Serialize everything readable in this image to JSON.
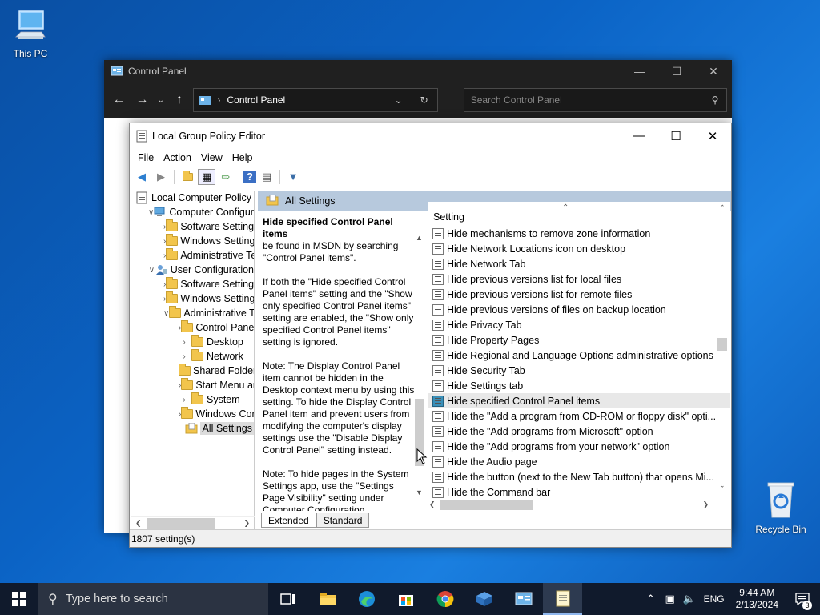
{
  "desktop": {
    "this_pc_label": "This PC",
    "recycle_bin_label": "Recycle Bin"
  },
  "control_panel": {
    "title": "Control Panel",
    "address": "Control Panel",
    "search_placeholder": "Search Control Panel"
  },
  "gpe": {
    "title": "Local Group Policy Editor",
    "menu": [
      "File",
      "Action",
      "View",
      "Help"
    ],
    "tree": [
      {
        "label": "Local Computer Policy",
        "level": 0,
        "toggle": "",
        "icon": "policy-icon"
      },
      {
        "label": "Computer Configura",
        "level": 1,
        "toggle": "v",
        "icon": "computer-icon"
      },
      {
        "label": "Software Settings",
        "level": 2,
        "toggle": ">",
        "icon": "folder-icon"
      },
      {
        "label": "Windows Setting",
        "level": 2,
        "toggle": ">",
        "icon": "folder-icon"
      },
      {
        "label": "Administrative Te",
        "level": 2,
        "toggle": ">",
        "icon": "folder-icon"
      },
      {
        "label": "User Configuration",
        "level": 1,
        "toggle": "v",
        "icon": "user-icon"
      },
      {
        "label": "Software Settings",
        "level": 2,
        "toggle": ">",
        "icon": "folder-icon"
      },
      {
        "label": "Windows Setting",
        "level": 2,
        "toggle": ">",
        "icon": "folder-icon"
      },
      {
        "label": "Administrative Te",
        "level": 2,
        "toggle": "v",
        "icon": "folder-icon"
      },
      {
        "label": "Control Panel",
        "level": 3,
        "toggle": ">",
        "icon": "folder-icon"
      },
      {
        "label": "Desktop",
        "level": 3,
        "toggle": ">",
        "icon": "folder-icon"
      },
      {
        "label": "Network",
        "level": 3,
        "toggle": ">",
        "icon": "folder-icon"
      },
      {
        "label": "Shared Folder",
        "level": 3,
        "toggle": "",
        "icon": "folder-icon"
      },
      {
        "label": "Start Menu ar",
        "level": 3,
        "toggle": ">",
        "icon": "folder-icon"
      },
      {
        "label": "System",
        "level": 3,
        "toggle": ">",
        "icon": "folder-icon"
      },
      {
        "label": "Windows Cor",
        "level": 3,
        "toggle": ">",
        "icon": "folder-icon"
      },
      {
        "label": "All Settings",
        "level": 3,
        "toggle": "",
        "icon": "all-settings-icon",
        "selected": true
      }
    ],
    "pane_header": "All Settings",
    "description": {
      "title": "Hide specified Control Panel items",
      "paragraphs": [
        "be found in MSDN by searching \"Control Panel items\".",
        "If both the \"Hide specified Control Panel items\" setting and the \"Show only specified Control Panel items\" setting are enabled, the \"Show only specified Control Panel items\" setting is ignored.",
        "Note: The Display Control Panel item cannot be hidden in the Desktop context menu by using this setting. To hide the Display Control Panel item and prevent users from modifying the computer's display settings use the \"Disable Display Control Panel\" setting instead.",
        "Note: To hide pages in the System Settings app, use the \"Settings Page Visibility\" setting under Computer Configuration."
      ]
    },
    "list_header": "Setting",
    "settings": [
      "Hide mechanisms to remove zone information",
      "Hide Network Locations icon on desktop",
      "Hide Network Tab",
      "Hide previous versions list for local files",
      "Hide previous versions list for remote files",
      "Hide previous versions of files on backup location",
      "Hide Privacy Tab",
      "Hide Property Pages",
      "Hide Regional and Language Options administrative options",
      "Hide Security Tab",
      "Hide Settings tab",
      "Hide specified Control Panel items",
      "Hide the \"Add a program from CD-ROM or floppy disk\" opti...",
      "Hide the \"Add programs from Microsoft\" option",
      "Hide the \"Add programs from your network\" option",
      "Hide the Audio page",
      "Hide the button (next to the New Tab button) that opens Mi...",
      "Hide the Command bar"
    ],
    "selected_setting_index": 11,
    "tabs": [
      "Extended",
      "Standard"
    ],
    "status": "1807 setting(s)"
  },
  "taskbar": {
    "search_placeholder": "Type here to search",
    "lang": "ENG",
    "time": "9:44 AM",
    "date": "2/13/2024",
    "notification_count": "3"
  }
}
